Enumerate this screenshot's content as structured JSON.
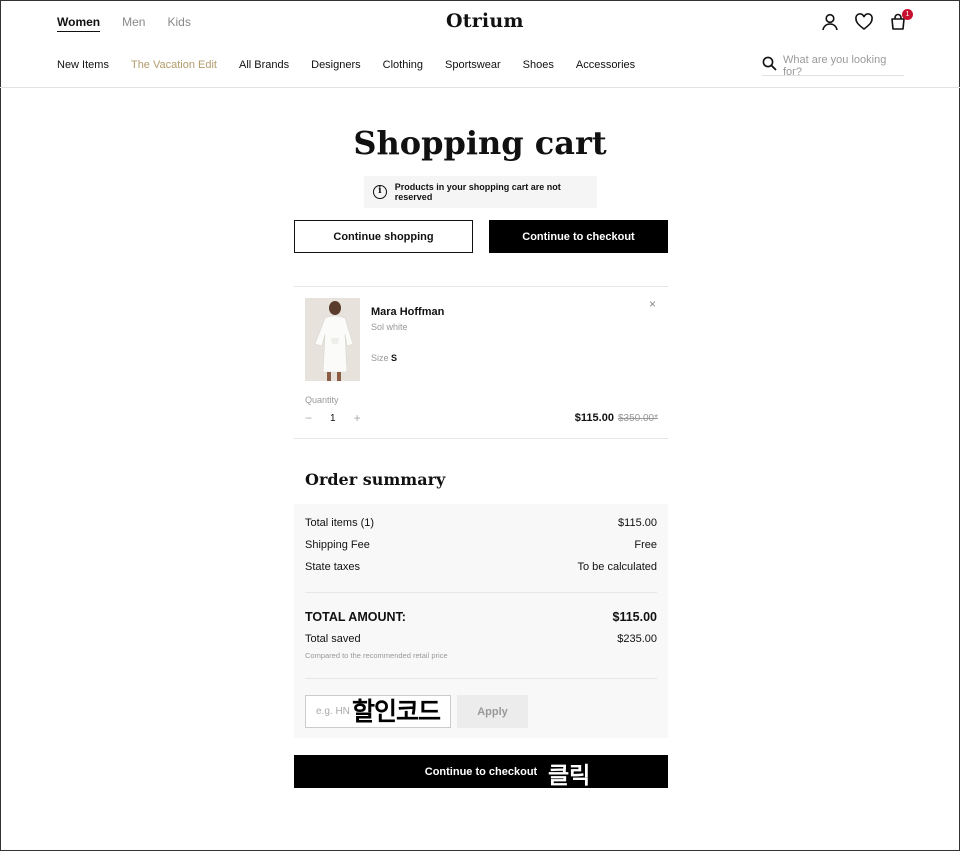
{
  "header": {
    "gender_tabs": [
      "Women",
      "Men",
      "Kids"
    ],
    "logo": "Otrium",
    "cart_count": "1",
    "nav": [
      "New Items",
      "The Vacation Edit",
      "All Brands",
      "Designers",
      "Clothing",
      "Sportswear",
      "Shoes",
      "Accessories"
    ],
    "search_placeholder": "What are you looking for?"
  },
  "page": {
    "title": "Shopping cart",
    "notice": "Products in your shopping cart are not reserved",
    "continue_shopping": "Continue shopping",
    "continue_checkout": "Continue to checkout"
  },
  "item": {
    "brand": "Mara Hoffman",
    "variant": "Sol white",
    "size_label": "Size",
    "size_value": "S",
    "quantity_label": "Quantity",
    "quantity": "1",
    "price": "$115.00",
    "old_price": "$350.00*",
    "remove": "×"
  },
  "summary": {
    "title": "Order summary",
    "total_items_label": "Total items (1)",
    "total_items_value": "$115.00",
    "shipping_label": "Shipping Fee",
    "shipping_value": "Free",
    "taxes_label": "State taxes",
    "taxes_value": "To be calculated",
    "total_label": "TOTAL AMOUNT:",
    "total_value": "$115.00",
    "saved_label": "Total saved",
    "saved_value": "$235.00",
    "saved_note": "Compared to the recommended retail price",
    "promo_placeholder": "e.g. HN",
    "apply": "Apply",
    "checkout": "Continue to checkout"
  },
  "annotations": {
    "promo": "할인코드",
    "click": "클릭"
  }
}
